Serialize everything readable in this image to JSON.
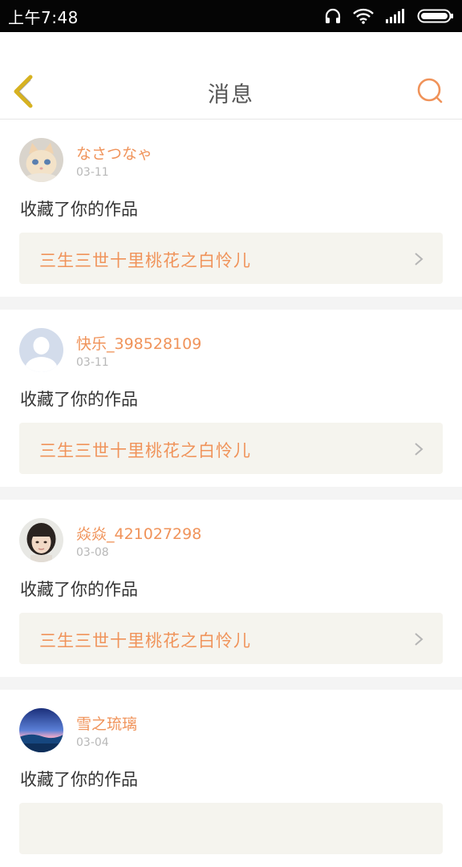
{
  "status_bar": {
    "time": "上午7:48",
    "icons": [
      "headset-icon",
      "wifi-icon",
      "signal-icon",
      "battery-icon"
    ]
  },
  "header": {
    "title": "消息",
    "back_icon": "chevron-left-icon",
    "search_icon": "search-icon"
  },
  "colors": {
    "accent": "#f0935a",
    "back_icon": "#d7b221",
    "work_box_bg": "#f5f4ee",
    "divider": "#f4f4f4"
  },
  "messages": [
    {
      "username": "なさつなゃ",
      "date": "03-11",
      "action": "收藏了你的作品",
      "work": "三生三世十里桃花之白怜儿",
      "avatar": "kitten-avatar"
    },
    {
      "username": "快乐_398528109",
      "date": "03-11",
      "action": "收藏了你的作品",
      "work": "三生三世十里桃花之白怜儿",
      "avatar": "default-avatar"
    },
    {
      "username": "焱焱_421027298",
      "date": "03-08",
      "action": "收藏了你的作品",
      "work": "三生三世十里桃花之白怜儿",
      "avatar": "girl-avatar"
    },
    {
      "username": "雪之琉璃",
      "date": "03-04",
      "action": "收藏了你的作品",
      "work": "",
      "avatar": "landscape-avatar"
    }
  ]
}
